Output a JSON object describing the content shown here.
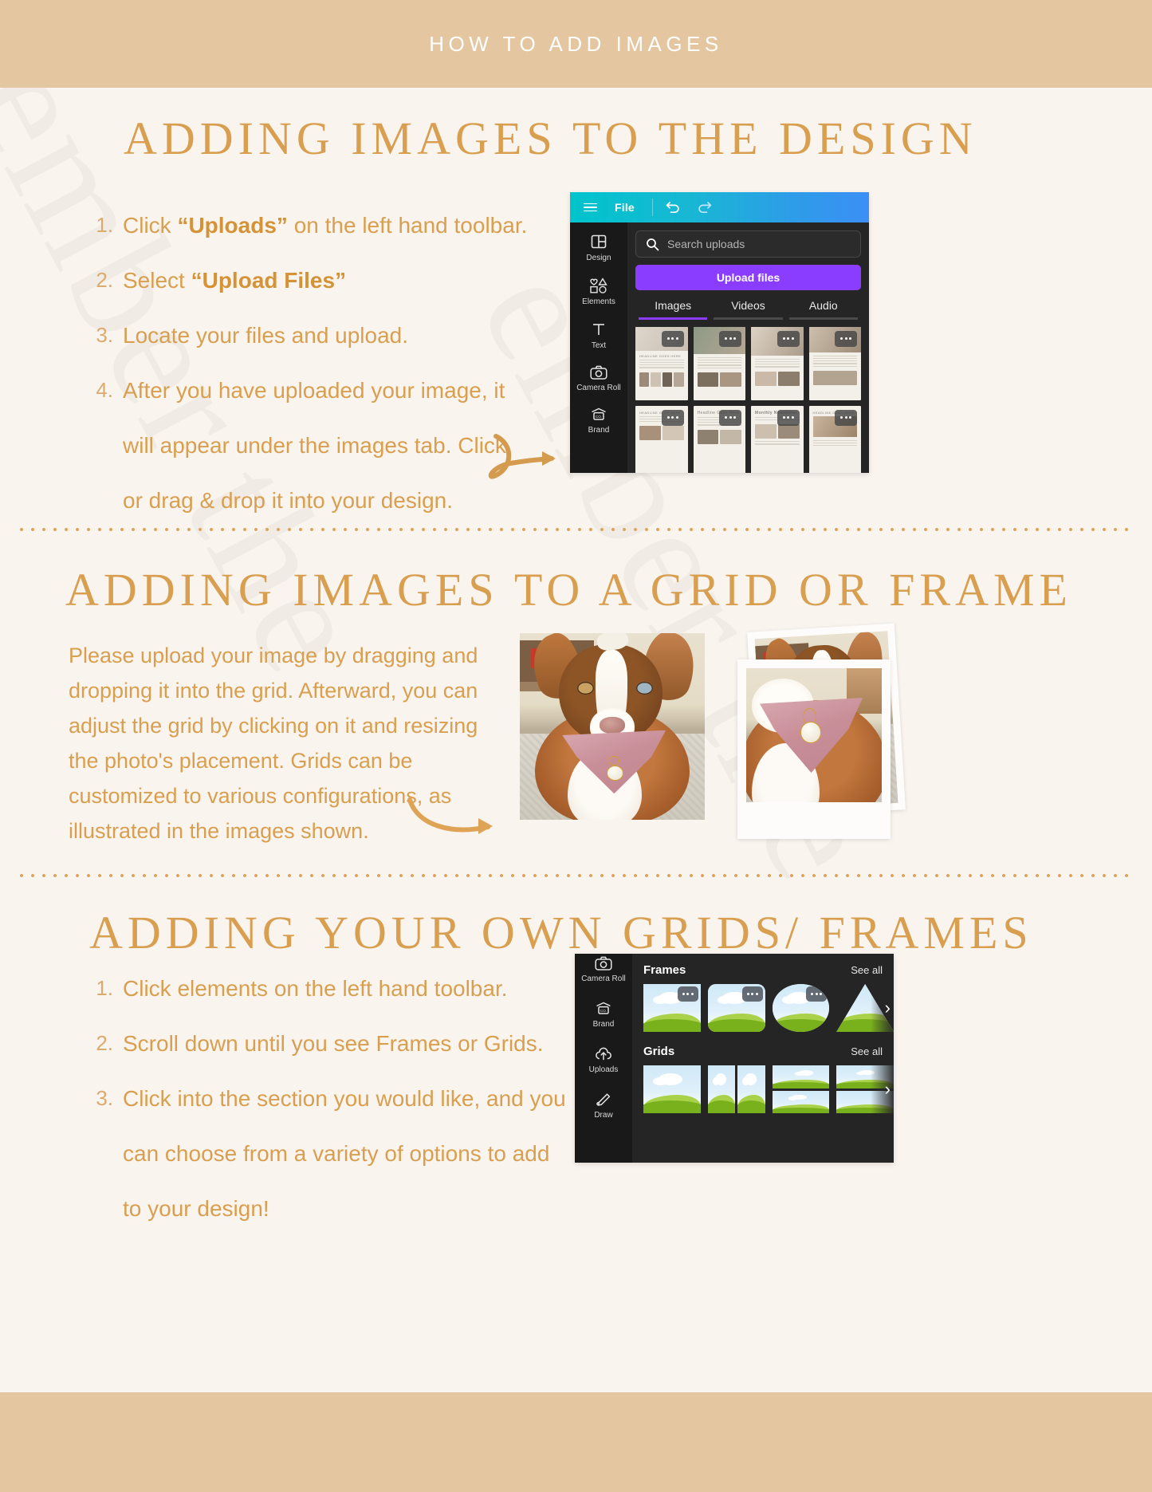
{
  "header": {
    "title": "HOW TO ADD IMAGES"
  },
  "colors": {
    "bar": "#e4c6a0",
    "page_bg": "#faf4ef",
    "accent": "#d99f50",
    "canva_purple": "#8b3dff",
    "canva_teal": "#00c4cc"
  },
  "section1": {
    "heading": "ADDING IMAGES TO THE DESIGN",
    "steps": [
      {
        "num": "1.",
        "before": "Click ",
        "bold": "“Uploads”",
        "after": " on the left hand toolbar."
      },
      {
        "num": "2.",
        "before": "Select ",
        "bold": "“Upload Files”",
        "after": ""
      },
      {
        "num": "3.",
        "before": "Locate your files and upload.",
        "bold": "",
        "after": ""
      },
      {
        "num": "4.",
        "before": "After you have uploaded your image, it will appear under the images tab. Click or drag & drop it into your design.",
        "bold": "",
        "after": ""
      }
    ],
    "canva": {
      "menu_icon": "hamburger-icon",
      "file_label": "File",
      "undo_icon": "undo-icon",
      "redo_icon": "redo-icon",
      "rail": [
        {
          "label": "Design",
          "icon": "layout-icon"
        },
        {
          "label": "Elements",
          "icon": "shapes-icon"
        },
        {
          "label": "Text",
          "icon": "text-icon"
        },
        {
          "label": "Camera Roll",
          "icon": "camera-icon"
        },
        {
          "label": "Brand",
          "icon": "brand-icon"
        }
      ],
      "search_placeholder": "Search uploads",
      "upload_button": "Upload files",
      "tabs": [
        {
          "label": "Images",
          "active": true
        },
        {
          "label": "Videos",
          "active": false
        },
        {
          "label": "Audio",
          "active": false
        }
      ],
      "thumbnails": [
        {
          "title": "HEADLINE GOES HERE"
        },
        {
          "title": ""
        },
        {
          "title": ""
        },
        {
          "title": ""
        },
        {
          "title": "HEADLINE GOES HERE"
        },
        {
          "title": "Headline Goes Here"
        },
        {
          "title": "Monthly Newsletter"
        },
        {
          "title": "HEADLINE GOES HERE"
        }
      ]
    }
  },
  "section2": {
    "heading": "ADDING IMAGES TO A GRID OR FRAME",
    "paragraph": "Please upload your image by dragging and dropping it into the grid. Afterward, you can adjust the grid by clicking on it and resizing the photo's placement. Grids can be customized to various configurations, as illustrated in the images shown.",
    "photos": [
      {
        "alt": "dog-in-pink-bandana-photo"
      },
      {
        "alt": "dog-polaroid-back-photo"
      },
      {
        "alt": "dog-bandana-closeup-polaroid-photo"
      }
    ]
  },
  "section3": {
    "heading": "ADDING YOUR OWN GRIDS/ FRAMES",
    "steps": [
      {
        "num": "1.",
        "text": "Click elements on the left hand toolbar."
      },
      {
        "num": "2.",
        "text": "Scroll down until you see Frames or Grids."
      },
      {
        "num": "3.",
        "text": "Click into the section you would like, and you can choose from a variety of options to add to your design!"
      }
    ],
    "canva": {
      "rail": [
        {
          "label": "Camera Roll",
          "icon": "camera-icon"
        },
        {
          "label": "Brand",
          "icon": "brand-icon"
        },
        {
          "label": "Uploads",
          "icon": "upload-cloud-icon"
        },
        {
          "label": "Draw",
          "icon": "pen-icon"
        }
      ],
      "groups": [
        {
          "title": "Frames",
          "see_all": "See all"
        },
        {
          "title": "Grids",
          "see_all": "See all"
        }
      ]
    }
  },
  "watermark": {
    "text": "ember the"
  }
}
